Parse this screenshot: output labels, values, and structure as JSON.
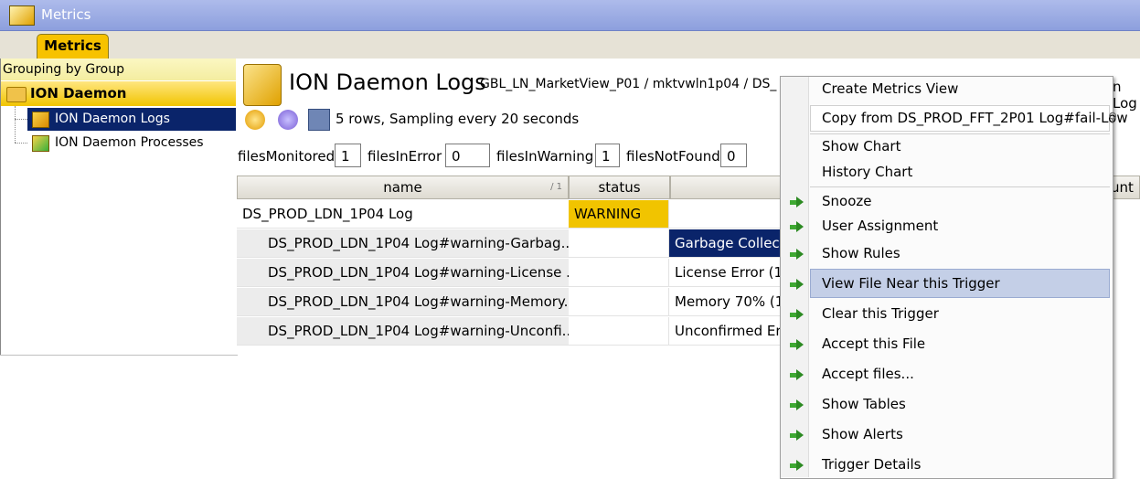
{
  "window": {
    "title": "Metrics"
  },
  "tabs": [
    {
      "label": "Metrics"
    }
  ],
  "sidebar": {
    "grouping": "Grouping by Group",
    "root": "ION Daemon",
    "items": [
      {
        "label": "ION Daemon Logs"
      },
      {
        "label": "ION Daemon Processes"
      }
    ]
  },
  "header": {
    "title": "ION Daemon Logs",
    "path": "GBL_LN_MarketView_P01 / mktvwln1p04 / DS_",
    "path_tail": "n Log",
    "sampling": "5 rows, Sampling every 20 seconds"
  },
  "counters": [
    {
      "label": "filesMonitored",
      "value": "1"
    },
    {
      "label": "filesInError",
      "value": "0"
    },
    {
      "label": "filesInWarning",
      "value": "1"
    },
    {
      "label": "filesNotFound",
      "value": "0"
    }
  ],
  "table": {
    "columns": [
      {
        "label": "name",
        "sort": "/ 1"
      },
      {
        "label": "status"
      },
      {
        "label": ""
      },
      {
        "label": "unt"
      }
    ],
    "rows": [
      {
        "name": "DS_PROD_LDN_1P04 Log",
        "status": "WARNING",
        "desc": ""
      },
      {
        "name": "DS_PROD_LDN_1P04 Log#warning-Garbag...",
        "status": "",
        "desc": "Garbage Collect"
      },
      {
        "name": "DS_PROD_LDN_1P04 Log#warning-License ...",
        "status": "",
        "desc": "License Error (1"
      },
      {
        "name": "DS_PROD_LDN_1P04 Log#warning-Memory...",
        "status": "",
        "desc": "Memory 70% (1"
      },
      {
        "name": "DS_PROD_LDN_1P04 Log#warning-Unconfi...",
        "status": "",
        "desc": "Unconfirmed Err"
      }
    ]
  },
  "context_menu": {
    "items": [
      {
        "label": "Create Metrics View"
      },
      {
        "label": "Copy from DS_PROD_FFT_2P01 Log#fail-Low"
      },
      {
        "label": "Show Chart"
      },
      {
        "label": "History Chart"
      },
      {
        "label": "Snooze"
      },
      {
        "label": "User Assignment"
      },
      {
        "label": "Show Rules"
      },
      {
        "label": "View File Near this Trigger"
      },
      {
        "label": "Clear this Trigger"
      },
      {
        "label": "Accept this File"
      },
      {
        "label": "Accept files..."
      },
      {
        "label": "Show Tables"
      },
      {
        "label": "Show Alerts"
      },
      {
        "label": "Trigger Details"
      }
    ]
  },
  "colors": {
    "selection": "#0a246a",
    "warning": "#f1c400",
    "menu_highlight": "#c4cfe7",
    "arrow": "#3ea932"
  },
  "icons": [
    "app-icon",
    "folder-icon",
    "log-icon",
    "process-icon",
    "refresh-icon",
    "pause-icon",
    "network-icon",
    "search-icon",
    "green-arrow-icon"
  ]
}
